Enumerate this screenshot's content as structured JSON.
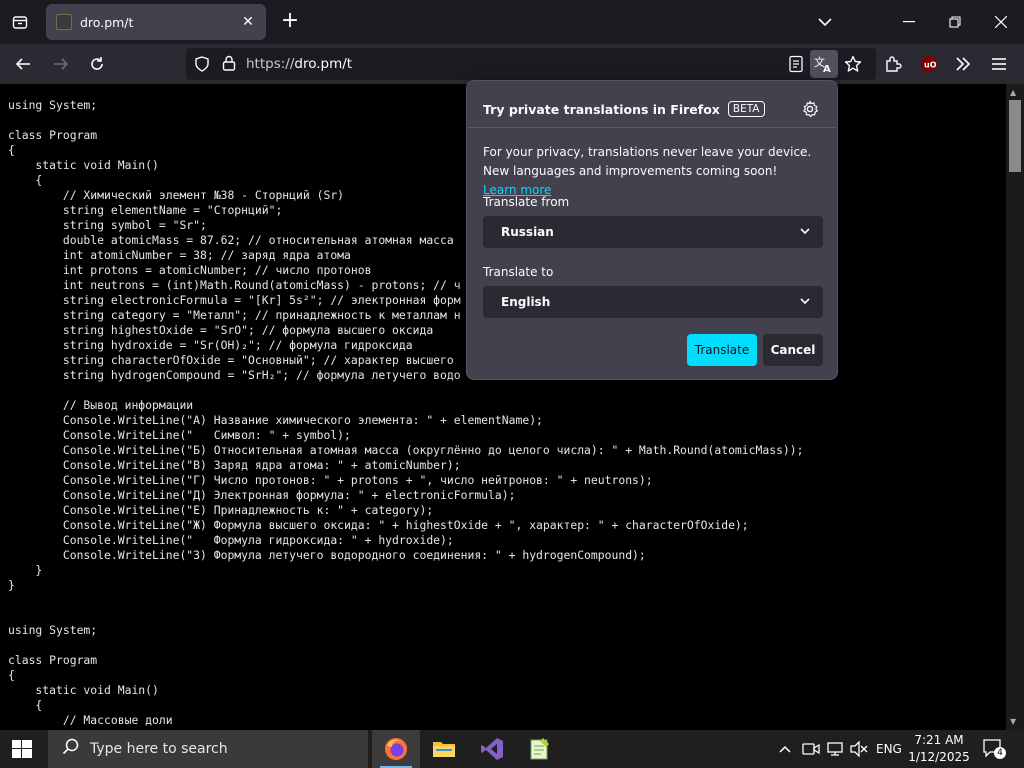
{
  "browser": {
    "tab": {
      "title": "dro.pm/t"
    },
    "newtab_label": "+",
    "url_prefix": "https://",
    "url_host": "dro.pm/t"
  },
  "page": {
    "code": "using System;\n\nclass Program\n{\n    static void Main()\n    {\n        // Химический элемент №38 - Сторнций (Sr)\n        string elementName = \"Сторнций\";\n        string symbol = \"Sr\";\n        double atomicMass = 87.62; // относительная атомная масса\n        int atomicNumber = 38; // заряд ядра атома\n        int protons = atomicNumber; // число протонов\n        int neutrons = (int)Math.Round(atomicMass) - protons; // ч\n        string electronicFormula = \"[Kr] 5s²\"; // электронная форм\n        string category = \"Металл\"; // принадлежность к металлам н\n        string highestOxide = \"SrO\"; // формула высшего оксида\n        string hydroxide = \"Sr(OH)₂\"; // формула гидроксида\n        string characterOfOxide = \"Основный\"; // характер высшего\n        string hydrogenCompound = \"SrH₂\"; // формула летучего водо\n\n        // Вывод информации\n        Console.WriteLine(\"А) Название химического элемента: \" + elementName);\n        Console.WriteLine(\"   Символ: \" + symbol);\n        Console.WriteLine(\"Б) Относительная атомная масса (округлённо до целого числа): \" + Math.Round(atomicMass));\n        Console.WriteLine(\"В) Заряд ядра атома: \" + atomicNumber);\n        Console.WriteLine(\"Г) Число протонов: \" + protons + \", число нейтронов: \" + neutrons);\n        Console.WriteLine(\"Д) Электронная формула: \" + electronicFormula);\n        Console.WriteLine(\"Е) Принадлежность к: \" + category);\n        Console.WriteLine(\"Ж) Формула высшего оксида: \" + highestOxide + \", характер: \" + characterOfOxide);\n        Console.WriteLine(\"   Формула гидроксида: \" + hydroxide);\n        Console.WriteLine(\"З) Формула летучего водородного соединения: \" + hydrogenCompound);\n    }\n}\n\n\nusing System;\n\nclass Program\n{\n    static void Main()\n    {\n        // Массовые доли"
  },
  "translation_panel": {
    "title": "Try private translations in Firefox",
    "beta": "BETA",
    "message": "For your privacy, translations never leave your device. New languages and improvements coming soon!",
    "learn_more": "Learn more",
    "from_label": "Translate from",
    "from_value": "Russian",
    "to_label": "Translate to",
    "to_value": "English",
    "translate_button": "Translate",
    "cancel_button": "Cancel"
  },
  "taskbar": {
    "search_placeholder": "Type here to search",
    "language": "ENG",
    "time": "7:21 AM",
    "date": "1/12/2025",
    "notification_count": "4"
  },
  "colors": {
    "accent": "#00ddff",
    "panel_bg": "#42414d",
    "toolbar_bg": "#2b2a33"
  }
}
